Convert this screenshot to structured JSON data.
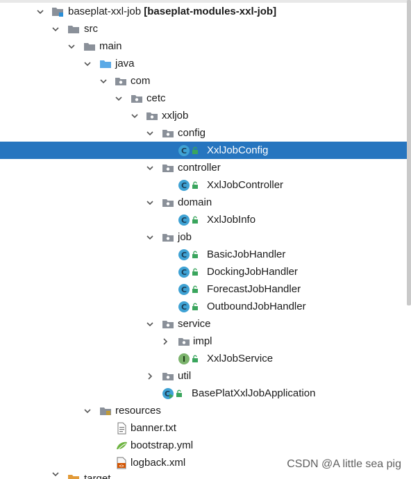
{
  "project": {
    "name": "baseplat-xxl-job",
    "module": "[baseplat-modules-xxl-job]"
  },
  "tree": {
    "src": "src",
    "main": "main",
    "java": "java",
    "com": "com",
    "cetc": "cetc",
    "xxljob": "xxljob",
    "config": "config",
    "xxljobconfig": "XxlJobConfig",
    "controller": "controller",
    "xxljobcontroller": "XxlJobController",
    "domain": "domain",
    "xxljobinfo": "XxlJobInfo",
    "job": "job",
    "basic": "BasicJobHandler",
    "docking": "DockingJobHandler",
    "forecast": "ForecastJobHandler",
    "outbound": "OutboundJobHandler",
    "service": "service",
    "impl": "impl",
    "xxljobservice": "XxlJobService",
    "util": "util",
    "app": "BasePlatXxlJobApplication",
    "resources": "resources",
    "banner": "banner.txt",
    "bootstrap": "bootstrap.yml",
    "logback": "logback.xml",
    "target": "target"
  },
  "icons": {
    "class_letter": "C",
    "interface_letter": "I",
    "xml_glyph": "<>"
  },
  "watermark": "CSDN @A little sea pig",
  "colors": {
    "selection": "#2675bf",
    "folder": "#8a9099",
    "source_folder": "#5aa9e6",
    "class_icon": "#3fa2d4",
    "interface_icon": "#7bb36c",
    "lock": "#3aa55d"
  }
}
